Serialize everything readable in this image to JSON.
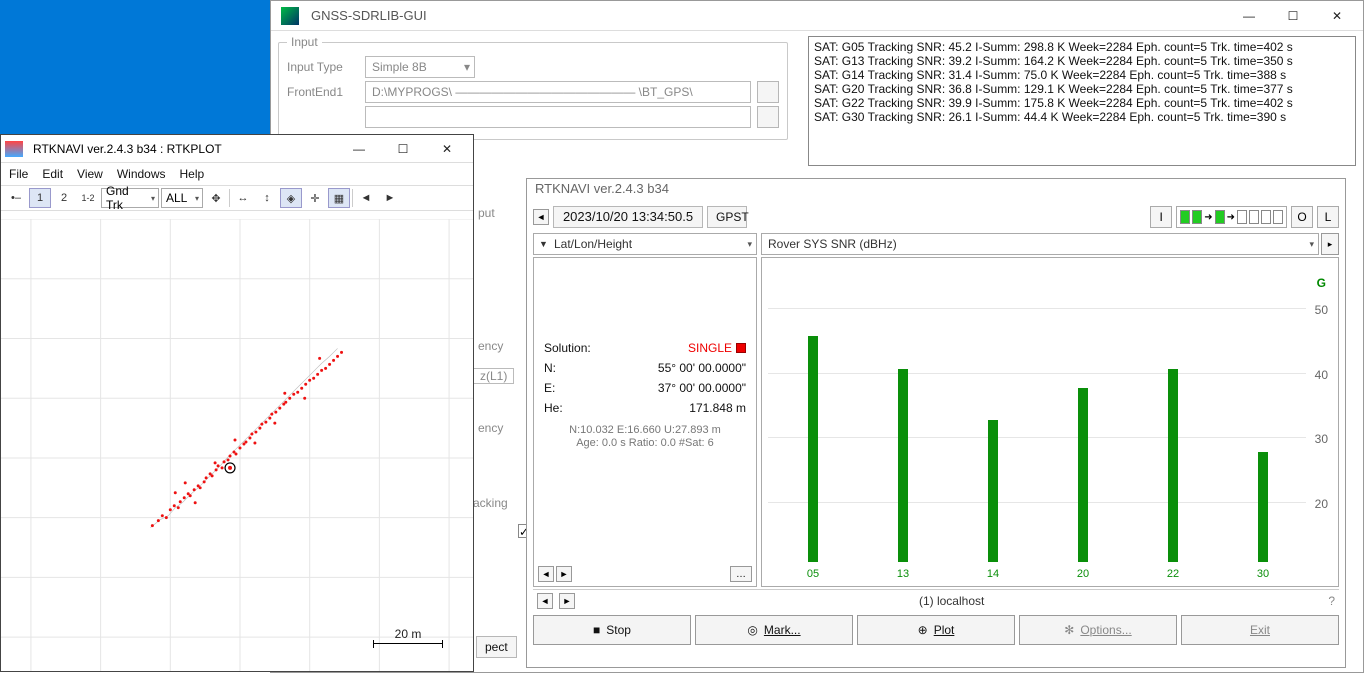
{
  "sdrlib": {
    "title": "GNSS-SDRLIB-GUI",
    "input_label": "Input",
    "input_type_label": "Input Type",
    "input_type_value": "Simple 8B",
    "frontend_label": "FrontEnd1",
    "frontend_path": "D:\\MYPROGS\\ ——————————————— \\BT_GPS\\",
    "log": [
      "SAT: G05 Tracking SNR: 45.2 I-Summ: 298.8 K Week=2284 Eph. count=5 Trk. time=402 s",
      "SAT: G13 Tracking SNR: 39.2 I-Summ: 164.2 K Week=2284 Eph. count=5 Trk. time=350 s",
      "SAT: G14 Tracking SNR: 31.4 I-Summ: 75.0 K Week=2284 Eph. count=5 Trk. time=388 s",
      "SAT: G20 Tracking SNR: 36.8 I-Summ: 129.1 K Week=2284 Eph. count=5 Trk. time=377 s",
      "SAT: G22 Tracking SNR: 39.9 I-Summ: 175.8 K Week=2284 Eph. count=5 Trk. time=402 s",
      "SAT: G30 Tracking SNR: 26.1 I-Summ: 44.4 K Week=2284 Eph. count=5 Trk. time=390 s"
    ],
    "partial_labels": {
      "put": "put",
      "ency": "ency",
      "zl1": "z(L1)",
      "acking": "acking",
      "pect": "pect"
    }
  },
  "rtknavi": {
    "title": "RTKNAVI ver.2.4.3 b34",
    "time": "2023/10/20 13:34:50.5",
    "timesys": "GPST",
    "ind_I": "I",
    "ind_O": "O",
    "ind_L": "L",
    "solpanel_header": "Lat/Lon/Height",
    "solution_label": "Solution:",
    "solution_value": "SINGLE",
    "kv": [
      {
        "k": "N:",
        "v": "55° 00' 00.0000\""
      },
      {
        "k": "E:",
        "v": "37° 00' 00.0000\""
      },
      {
        "k": "He:",
        "v": "171.848 m"
      }
    ],
    "fine1": "N:10.032 E:16.660 U:27.893 m",
    "fine2": "Age: 0.0 s Ratio: 0.0 #Sat: 6",
    "snr_header": "Rover  SYS SNR (dBHz)",
    "snr_sys": "G",
    "status": "(1) localhost",
    "buttons": {
      "stop": "Stop",
      "mark": "Mark...",
      "plot": "Plot",
      "options": "Options...",
      "exit": "Exit"
    }
  },
  "chart_data": {
    "type": "bar",
    "title": "Rover SYS SNR (dBHz)",
    "ylabel": "SNR (dBHz)",
    "ylim": [
      10,
      55
    ],
    "yticks": [
      20,
      30,
      40,
      50
    ],
    "categories": [
      "05",
      "13",
      "14",
      "20",
      "22",
      "30"
    ],
    "values": [
      45,
      40,
      32,
      37,
      40,
      27
    ]
  },
  "rtkplot": {
    "title": "RTKNAVI ver.2.4.3 b34 : RTKPLOT",
    "menus": [
      "File",
      "Edit",
      "View",
      "Windows",
      "Help"
    ],
    "toolbar": {
      "n1": "1",
      "n2": "2",
      "n12": "1-2",
      "sel1": "Gnd Trk",
      "sel2": "ALL"
    },
    "scale": "20 m"
  }
}
